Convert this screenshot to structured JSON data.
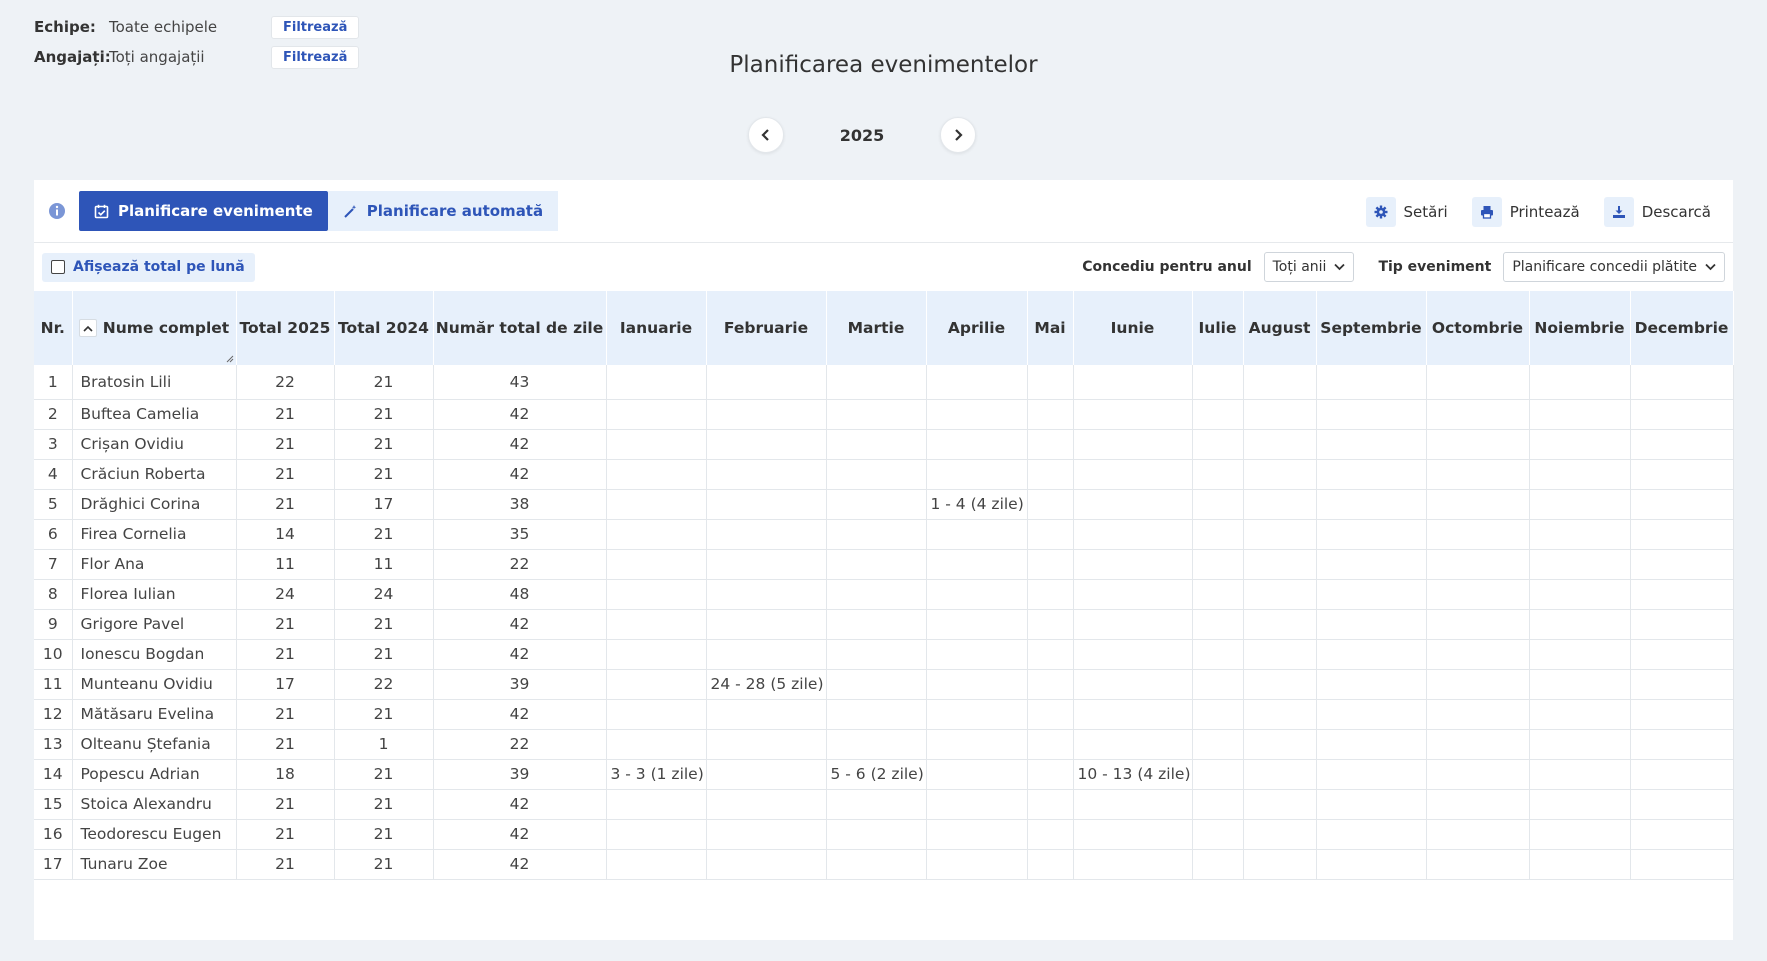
{
  "filters": {
    "teams_label": "Echipe:",
    "teams_value": "Toate echipele",
    "employees_label": "Angajați:",
    "employees_value": "Toți angajații",
    "filter_button": "Filtrează"
  },
  "title": "Planificarea evenimentelor",
  "year": "2025",
  "toolbar": {
    "tab_events": "Planificare evenimente",
    "tab_auto": "Planificare automată",
    "settings": "Setări",
    "print": "Printează",
    "download": "Descarcă"
  },
  "subbar": {
    "monthly_total": "Afișează total pe lună",
    "leave_year_label": "Concediu pentru anul",
    "leave_year_value": "Toți anii",
    "event_type_label": "Tip eveniment",
    "event_type_value": "Planificare concedii plătite"
  },
  "columns": [
    "Nr.",
    "Nume complet",
    "Total 2025",
    "Total 2024",
    "Număr total de zile",
    "Ianuarie",
    "Februarie",
    "Martie",
    "Aprilie",
    "Mai",
    "Iunie",
    "Iulie",
    "August",
    "Septembrie",
    "Octombrie",
    "Noiembrie",
    "Decembrie"
  ],
  "rows": [
    [
      "1",
      "Bratosin Lili",
      "22",
      "21",
      "43",
      "",
      "",
      "",
      "",
      "",
      "",
      "",
      "",
      "",
      "",
      "",
      ""
    ],
    [
      "2",
      "Buftea Camelia",
      "21",
      "21",
      "42",
      "",
      "",
      "",
      "",
      "",
      "",
      "",
      "",
      "",
      "",
      "",
      ""
    ],
    [
      "3",
      "Crișan Ovidiu",
      "21",
      "21",
      "42",
      "",
      "",
      "",
      "",
      "",
      "",
      "",
      "",
      "",
      "",
      "",
      ""
    ],
    [
      "4",
      "Crăciun Roberta",
      "21",
      "21",
      "42",
      "",
      "",
      "",
      "",
      "",
      "",
      "",
      "",
      "",
      "",
      "",
      ""
    ],
    [
      "5",
      "Drăghici Corina",
      "21",
      "17",
      "38",
      "",
      "",
      "",
      "1 - 4 (4 zile)",
      "",
      "",
      "",
      "",
      "",
      "",
      "",
      ""
    ],
    [
      "6",
      "Firea Cornelia",
      "14",
      "21",
      "35",
      "",
      "",
      "",
      "",
      "",
      "",
      "",
      "",
      "",
      "",
      "",
      ""
    ],
    [
      "7",
      "Flor Ana",
      "11",
      "11",
      "22",
      "",
      "",
      "",
      "",
      "",
      "",
      "",
      "",
      "",
      "",
      "",
      ""
    ],
    [
      "8",
      "Florea Iulian",
      "24",
      "24",
      "48",
      "",
      "",
      "",
      "",
      "",
      "",
      "",
      "",
      "",
      "",
      "",
      ""
    ],
    [
      "9",
      "Grigore Pavel",
      "21",
      "21",
      "42",
      "",
      "",
      "",
      "",
      "",
      "",
      "",
      "",
      "",
      "",
      "",
      ""
    ],
    [
      "10",
      "Ionescu Bogdan",
      "21",
      "21",
      "42",
      "",
      "",
      "",
      "",
      "",
      "",
      "",
      "",
      "",
      "",
      "",
      ""
    ],
    [
      "11",
      "Munteanu Ovidiu",
      "17",
      "22",
      "39",
      "",
      "24 - 28 (5 zile)",
      "",
      "",
      "",
      "",
      "",
      "",
      "",
      "",
      "",
      ""
    ],
    [
      "12",
      "Mătăsaru Evelina",
      "21",
      "21",
      "42",
      "",
      "",
      "",
      "",
      "",
      "",
      "",
      "",
      "",
      "",
      "",
      ""
    ],
    [
      "13",
      "Olteanu Ștefania",
      "21",
      "1",
      "22",
      "",
      "",
      "",
      "",
      "",
      "",
      "",
      "",
      "",
      "",
      "",
      ""
    ],
    [
      "14",
      "Popescu Adrian",
      "18",
      "21",
      "39",
      "3 - 3 (1 zile)",
      "",
      "5 - 6 (2 zile)",
      "",
      "",
      "10 - 13 (4 zile)",
      "",
      "",
      "",
      "",
      "",
      ""
    ],
    [
      "15",
      "Stoica Alexandru",
      "21",
      "21",
      "42",
      "",
      "",
      "",
      "",
      "",
      "",
      "",
      "",
      "",
      "",
      "",
      ""
    ],
    [
      "16",
      "Teodorescu Eugen",
      "21",
      "21",
      "42",
      "",
      "",
      "",
      "",
      "",
      "",
      "",
      "",
      "",
      "",
      "",
      ""
    ],
    [
      "17",
      "Tunaru Zoe",
      "21",
      "21",
      "42",
      "",
      "",
      "",
      "",
      "",
      "",
      "",
      "",
      "",
      "",
      "",
      ""
    ]
  ],
  "colors": {
    "accent": "#2e55b8",
    "accent_light": "#e7f0fb",
    "background": "#eef2f6"
  }
}
